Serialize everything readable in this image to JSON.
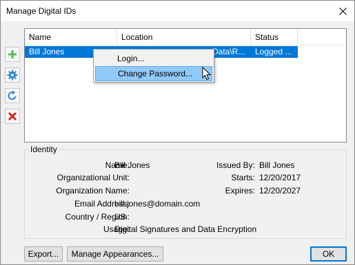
{
  "window": {
    "title": "Manage Digital IDs"
  },
  "toolbar": {
    "add_icon": "plus-icon",
    "settings_icon": "gear-icon",
    "refresh_icon": "refresh-icon",
    "delete_icon": "delete-x-icon"
  },
  "list": {
    "columns": [
      "Name",
      "Location",
      "Status"
    ],
    "rows": [
      {
        "name": "Bill Jones",
        "location": "Data\\R...",
        "status": "Logged ..."
      }
    ]
  },
  "context_menu": {
    "items": [
      "Login...",
      "Change Password..."
    ],
    "hovered": "Change Password..."
  },
  "identity": {
    "legend": "Identity",
    "fields": {
      "name": {
        "label": "Name:",
        "value": "Bill Jones"
      },
      "org_unit": {
        "label": "Organizational Unit:",
        "value": ""
      },
      "org_name": {
        "label": "Organization Name:",
        "value": ""
      },
      "email": {
        "label": "Email Address:",
        "value": "bill.jones@domain.com"
      },
      "country": {
        "label": "Country / Region:",
        "value": "US"
      },
      "usage": {
        "label": "Usage:",
        "value": "Digital Signatures and Data Encryption"
      },
      "issued_by": {
        "label": "Issued By:",
        "value": "Bill Jones"
      },
      "starts": {
        "label": "Starts:",
        "value": "12/20/2017"
      },
      "expires": {
        "label": "Expires:",
        "value": "12/20/2027"
      }
    }
  },
  "buttons": {
    "export": "Export...",
    "manage_appearances": "Manage Appearances...",
    "ok": "OK"
  },
  "colors": {
    "selection": "#0078d7",
    "menu_hover": "#91c9f7",
    "add_green": "#5cb85c",
    "gear_blue": "#2b86d6",
    "delete_red": "#d9241c"
  }
}
